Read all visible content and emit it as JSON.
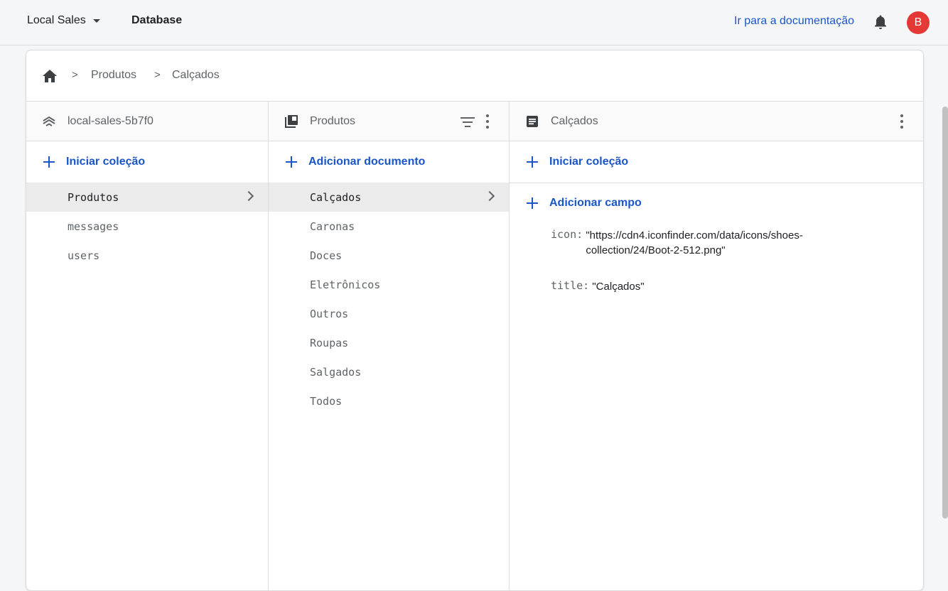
{
  "topbar": {
    "project": "Local Sales",
    "section": "Database",
    "docs_link": "Ir para a documentação",
    "avatar_letter": "B"
  },
  "breadcrumb": {
    "items": [
      "Produtos",
      "Calçados"
    ]
  },
  "columns": {
    "root": {
      "title": "local-sales-5b7f0",
      "action": "Iniciar coleção",
      "items": [
        "Produtos",
        "messages",
        "users"
      ],
      "selected": "Produtos"
    },
    "collection": {
      "title": "Produtos",
      "action": "Adicionar documento",
      "items": [
        "Calçados",
        "Caronas",
        "Doces",
        "Eletrônicos",
        "Outros",
        "Roupas",
        "Salgados",
        "Todos"
      ],
      "selected": "Calçados"
    },
    "document": {
      "title": "Calçados",
      "action": "Iniciar coleção",
      "add_field": "Adicionar campo",
      "fields": [
        {
          "key": "icon:",
          "value": "\"https://cdn4.iconfinder.com/data/icons/shoes-collection/24/Boot-2-512.png\""
        },
        {
          "key": "title:",
          "value": "\"Calçados\""
        }
      ]
    }
  },
  "colors": {
    "accent": "#1a56c9",
    "avatar": "#e53935",
    "selected_row": "#ebebeb"
  }
}
